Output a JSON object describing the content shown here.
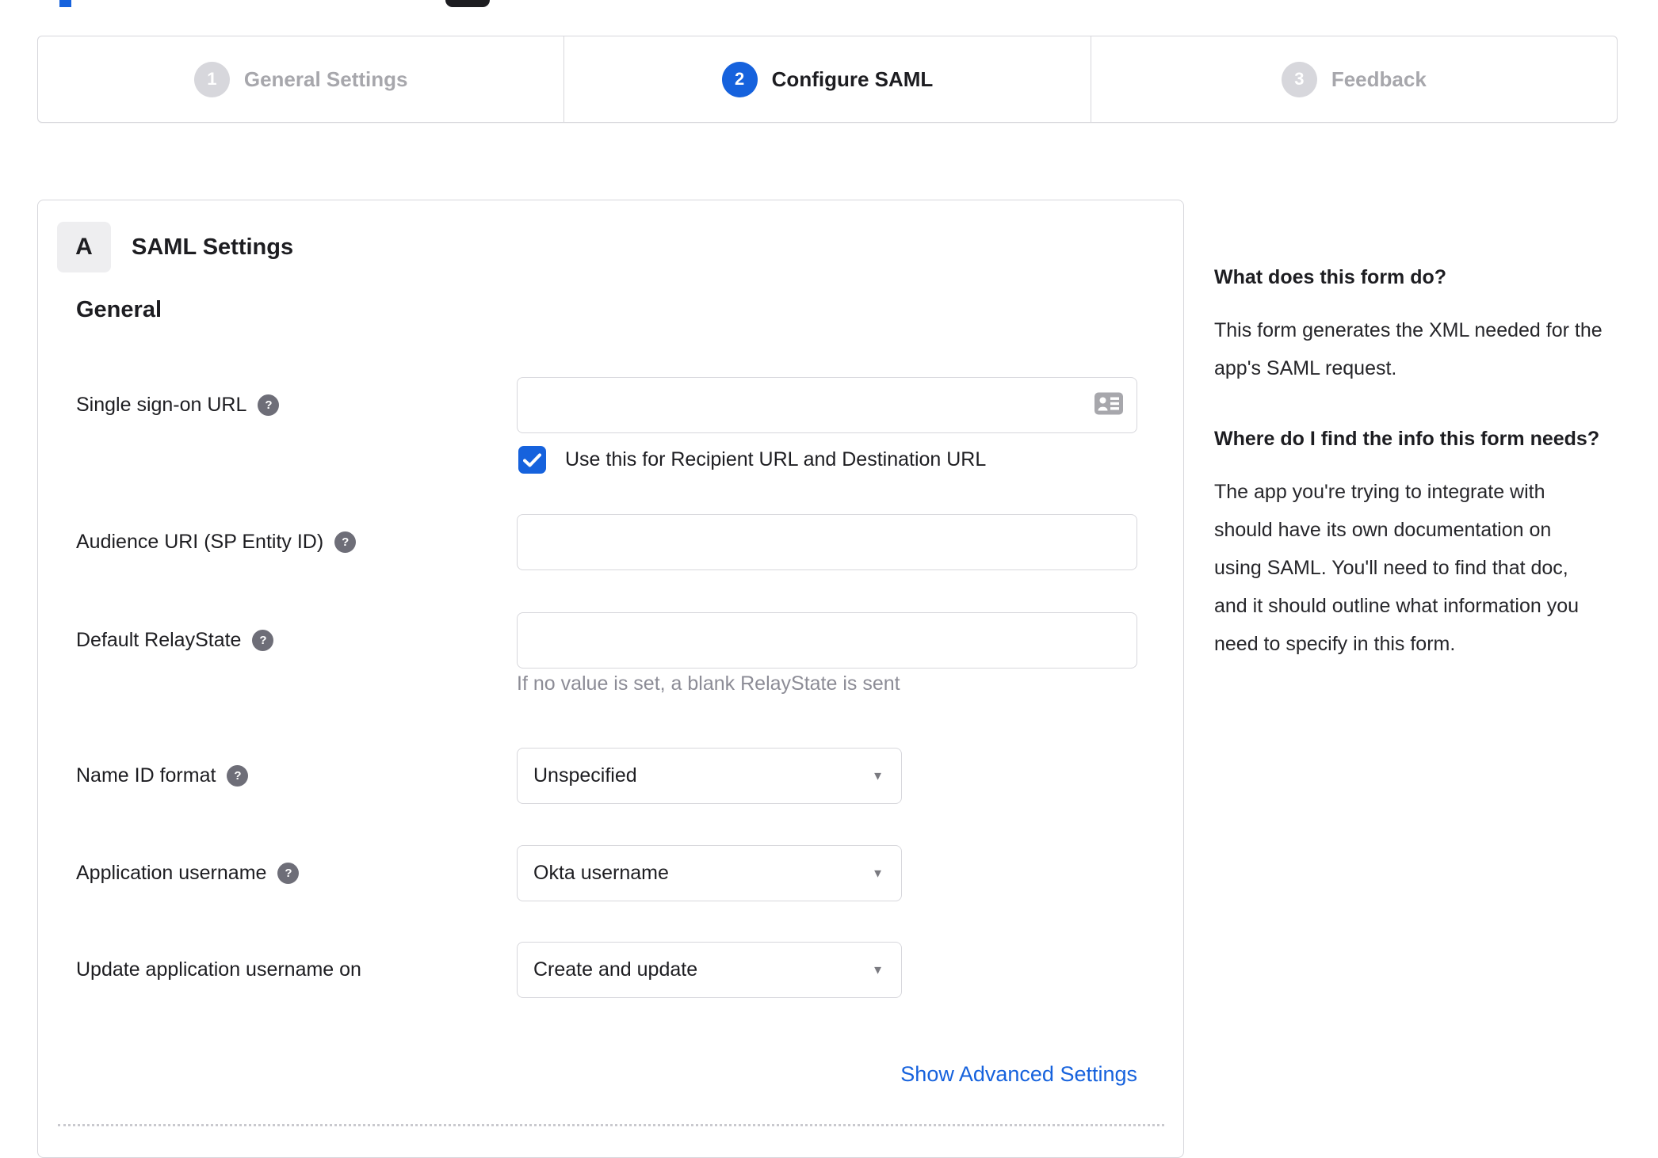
{
  "colors": {
    "accent": "#1662dd",
    "border": "#d7d7dc",
    "inactive_grey": "#a7a7ac",
    "help_icon_bg": "#6e6e78",
    "hint_grey": "#8c8c96"
  },
  "icons": {
    "help_glyph": "?",
    "caret_down": "▼"
  },
  "stepper": {
    "steps": [
      {
        "number": "1",
        "label": "General Settings",
        "state": "inactive"
      },
      {
        "number": "2",
        "label": "Configure SAML",
        "state": "active"
      },
      {
        "number": "3",
        "label": "Feedback",
        "state": "inactive"
      }
    ]
  },
  "panel": {
    "section_badge": "A",
    "section_title": "SAML Settings",
    "group_heading": "General",
    "sso": {
      "label": "Single sign-on URL",
      "value": "",
      "checkbox_label": "Use this for Recipient URL and Destination URL",
      "checked": true
    },
    "audience": {
      "label": "Audience URI (SP Entity ID)",
      "value": ""
    },
    "relay": {
      "label": "Default RelayState",
      "value": "",
      "hint": "If no value is set, a blank RelayState is sent"
    },
    "nameid": {
      "label": "Name ID format",
      "value": "Unspecified"
    },
    "appuser": {
      "label": "Application username",
      "value": "Okta username"
    },
    "updateuser": {
      "label": "Update application username on",
      "value": "Create and update"
    },
    "advanced_link": "Show Advanced Settings"
  },
  "sidebar": {
    "q1": "What does this form do?",
    "a1": "This form generates the XML needed for the app's SAML request.",
    "q2": "Where do I find the info this form needs?",
    "a2": "The app you're trying to integrate with should have its own documentation on using SAML. You'll need to find that doc, and it should outline what information you need to specify in this form."
  }
}
